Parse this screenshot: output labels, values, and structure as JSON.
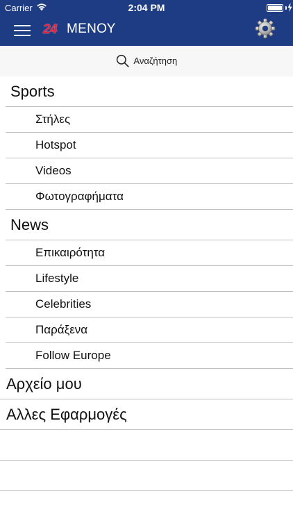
{
  "status_bar": {
    "carrier": "Carrier",
    "time": "2:04 PM",
    "battery_level": 1.0,
    "charging": true
  },
  "nav": {
    "logo_text": "24",
    "title": "ΜΕΝΟΥ",
    "background_color": "#1d3c84",
    "logo_color": "#e5203a",
    "left_icon": "hamburger-menu-icon",
    "right_icon": "gear-icon"
  },
  "search": {
    "label": "Αναζήτηση",
    "icon": "search-icon"
  },
  "menu": {
    "sports": {
      "label": "Sports",
      "items": [
        "Στήλες",
        "Hotspot",
        "Videos",
        "Φωτογραφήματα"
      ]
    },
    "news": {
      "label": "News",
      "items": [
        "Επικαιρότητα",
        "Lifestyle",
        "Celebrities",
        "Παράξενα",
        "Follow Europe"
      ]
    },
    "archive": {
      "label": "Αρχείο μου"
    },
    "other_apps": {
      "label": "Αλλες Εφαρμογές"
    }
  }
}
